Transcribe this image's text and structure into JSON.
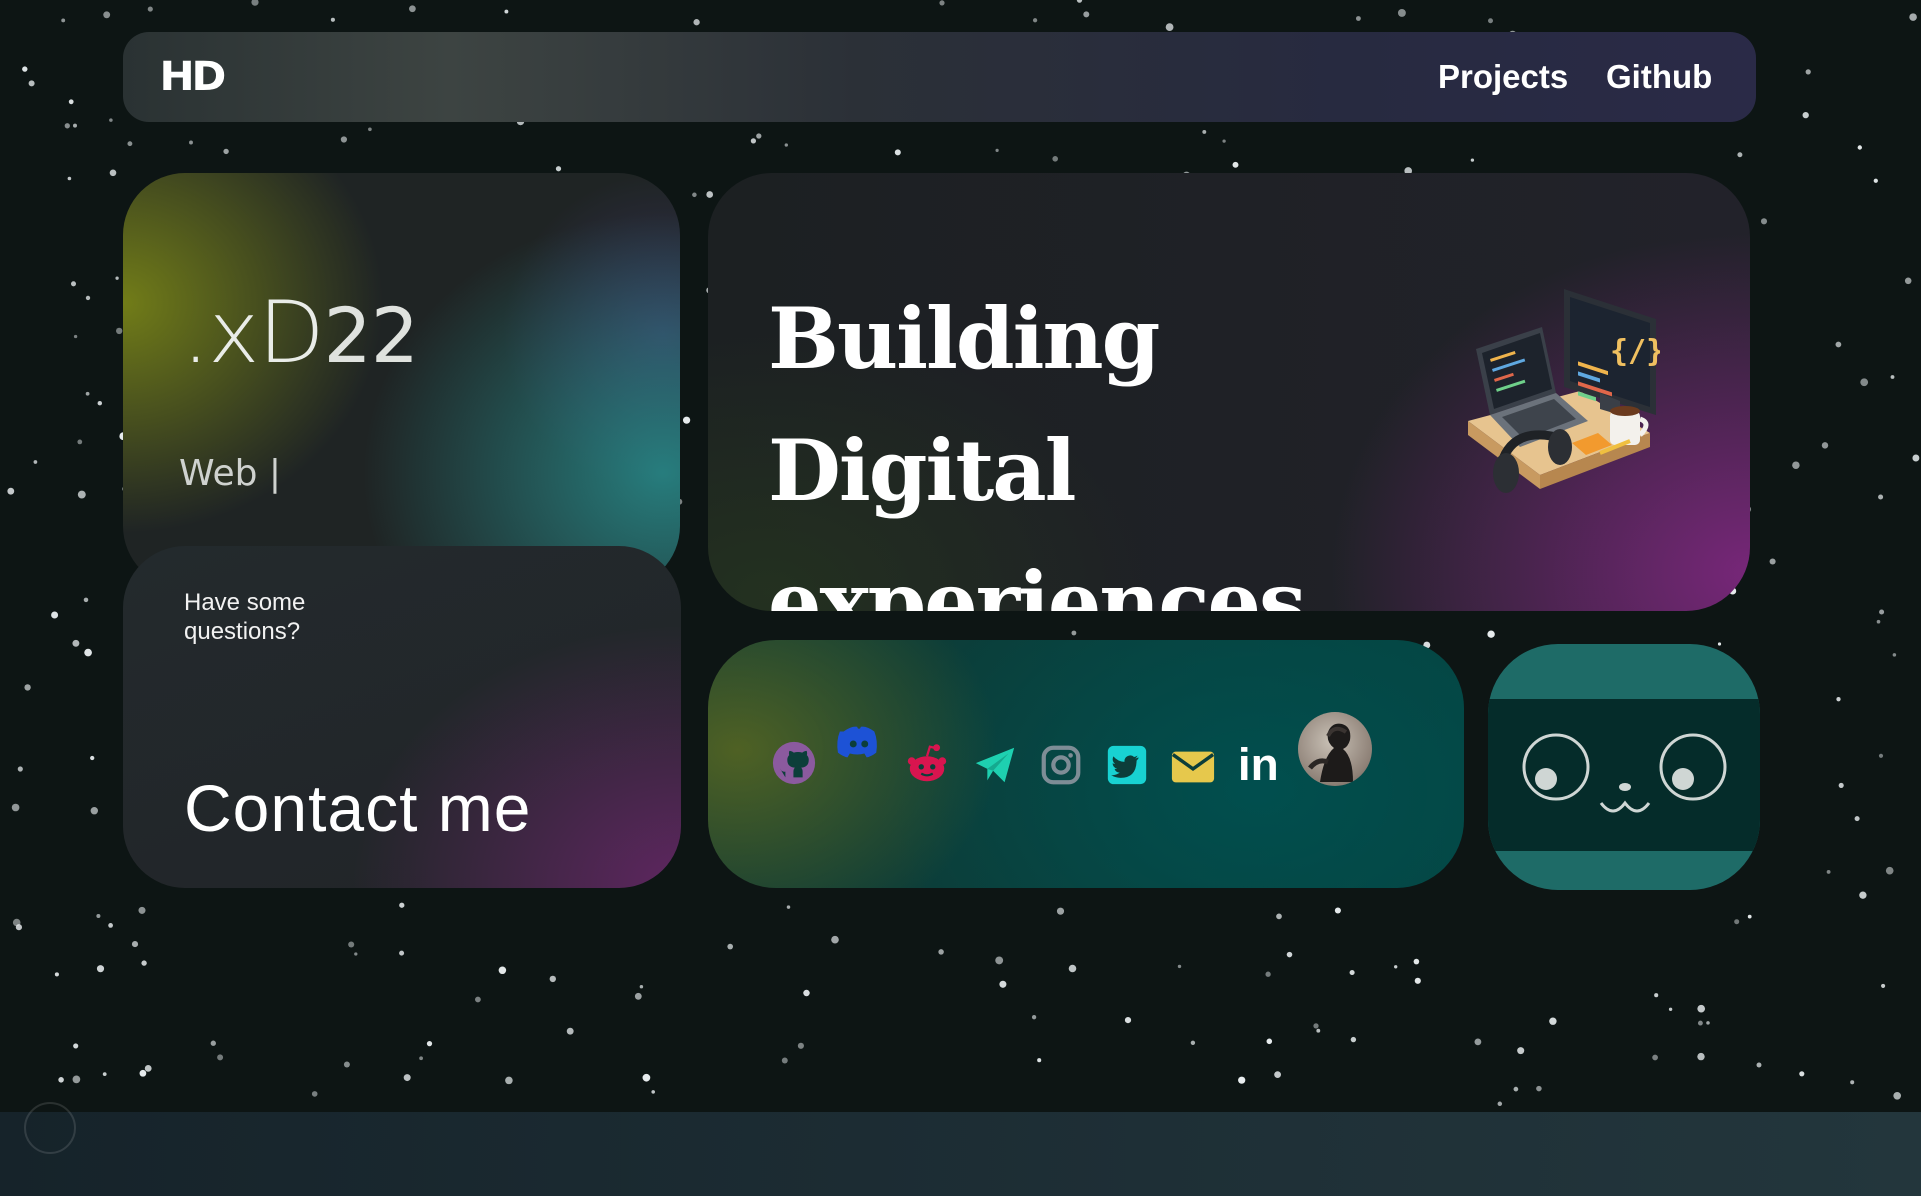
{
  "navbar": {
    "logo": "HD",
    "links": [
      "Projects",
      "Github"
    ]
  },
  "brand_card": {
    "name": ".xD",
    "name_suffix": "22",
    "typing_text": "Web |"
  },
  "contact_card": {
    "question": "Have some questions?",
    "cta": "Contact me"
  },
  "hero": {
    "title_line1": "Building Digital",
    "title_line2": "experiences.",
    "illustration_icon": "desk-computer-illustration",
    "illustration_code_text": "{/}"
  },
  "social": {
    "icons": [
      {
        "name": "github-icon",
        "color": "#8b5a9e"
      },
      {
        "name": "discord-icon",
        "color": "#1d52d6"
      },
      {
        "name": "reddit-icon",
        "color": "#d8154f"
      },
      {
        "name": "telegram-icon",
        "color": "#1ed0b0"
      },
      {
        "name": "instagram-icon",
        "color": "#7e8d96"
      },
      {
        "name": "twitter-icon",
        "color": "#18d2d2"
      },
      {
        "name": "email-icon",
        "color": "#e6c84c"
      },
      {
        "name": "linkedin-icon",
        "color": "#ffffff",
        "text": "in"
      },
      {
        "name": "avatar",
        "color": "#a59b90"
      }
    ]
  },
  "mascot": {
    "icon": "cat-face-icon",
    "card_color": "#1e6b67",
    "face_color": "#052c2a"
  },
  "theme": {
    "background": "#0d1514",
    "footer": "#1c2c33",
    "stars": "#e9eef0"
  }
}
